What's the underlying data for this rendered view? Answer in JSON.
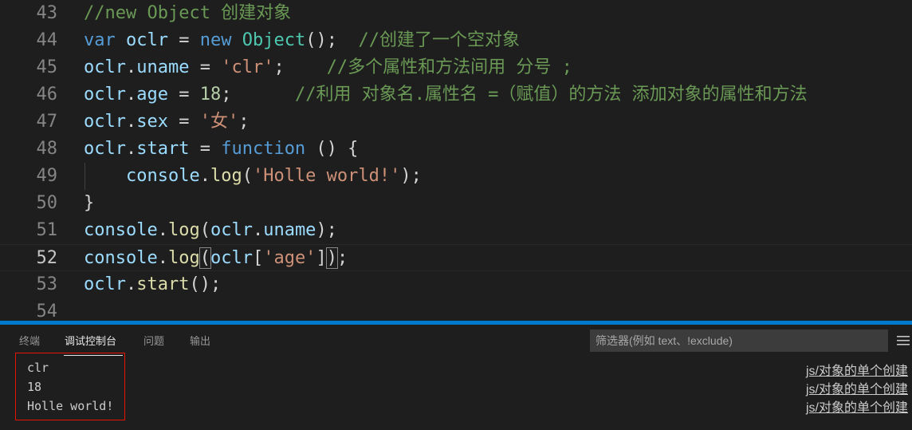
{
  "editor": {
    "lines": [
      {
        "num": "43",
        "tokens": [
          {
            "t": "//new Object 创建对象",
            "c": "cm"
          }
        ]
      },
      {
        "num": "44",
        "tokens": [
          {
            "t": "var",
            "c": "kw"
          },
          {
            "t": " ",
            "c": "pu"
          },
          {
            "t": "oclr",
            "c": "va"
          },
          {
            "t": " = ",
            "c": "pu"
          },
          {
            "t": "new",
            "c": "kw"
          },
          {
            "t": " ",
            "c": "pu"
          },
          {
            "t": "Object",
            "c": "ty"
          },
          {
            "t": "();  ",
            "c": "pu"
          },
          {
            "t": "//创建了一个空对象",
            "c": "cm"
          }
        ]
      },
      {
        "num": "45",
        "tokens": [
          {
            "t": "oclr",
            "c": "va"
          },
          {
            "t": ".",
            "c": "pu"
          },
          {
            "t": "uname",
            "c": "va"
          },
          {
            "t": " = ",
            "c": "pu"
          },
          {
            "t": "'clr'",
            "c": "st"
          },
          {
            "t": ";    ",
            "c": "pu"
          },
          {
            "t": "//多个属性和方法间用 分号 ;",
            "c": "cm"
          }
        ]
      },
      {
        "num": "46",
        "tokens": [
          {
            "t": "oclr",
            "c": "va"
          },
          {
            "t": ".",
            "c": "pu"
          },
          {
            "t": "age",
            "c": "va"
          },
          {
            "t": " = ",
            "c": "pu"
          },
          {
            "t": "18",
            "c": "nu"
          },
          {
            "t": ";      ",
            "c": "pu"
          },
          {
            "t": "//利用 对象名.属性名 =（赋值）的方法 添加对象的属性和方法",
            "c": "cm"
          }
        ]
      },
      {
        "num": "47",
        "tokens": [
          {
            "t": "oclr",
            "c": "va"
          },
          {
            "t": ".",
            "c": "pu"
          },
          {
            "t": "sex",
            "c": "va"
          },
          {
            "t": " = ",
            "c": "pu"
          },
          {
            "t": "'女'",
            "c": "st"
          },
          {
            "t": ";",
            "c": "pu"
          }
        ]
      },
      {
        "num": "48",
        "tokens": [
          {
            "t": "oclr",
            "c": "va"
          },
          {
            "t": ".",
            "c": "pu"
          },
          {
            "t": "start",
            "c": "va"
          },
          {
            "t": " = ",
            "c": "pu"
          },
          {
            "t": "function",
            "c": "kw"
          },
          {
            "t": " () {",
            "c": "pu"
          }
        ]
      },
      {
        "num": "49",
        "tokens": [
          {
            "t": "    ",
            "c": "pu"
          },
          {
            "t": "console",
            "c": "va"
          },
          {
            "t": ".",
            "c": "pu"
          },
          {
            "t": "log",
            "c": "fn"
          },
          {
            "t": "(",
            "c": "pu"
          },
          {
            "t": "'Holle world!'",
            "c": "st"
          },
          {
            "t": ");",
            "c": "pu"
          }
        ]
      },
      {
        "num": "50",
        "tokens": [
          {
            "t": "}",
            "c": "pu"
          }
        ]
      },
      {
        "num": "51",
        "tokens": [
          {
            "t": "console",
            "c": "va"
          },
          {
            "t": ".",
            "c": "pu"
          },
          {
            "t": "log",
            "c": "fn"
          },
          {
            "t": "(",
            "c": "pu"
          },
          {
            "t": "oclr",
            "c": "va"
          },
          {
            "t": ".",
            "c": "pu"
          },
          {
            "t": "uname",
            "c": "va"
          },
          {
            "t": ");",
            "c": "pu"
          }
        ]
      },
      {
        "num": "52",
        "current": true,
        "tokens": [
          {
            "t": "console",
            "c": "va"
          },
          {
            "t": ".",
            "c": "pu"
          },
          {
            "t": "log",
            "c": "fn"
          },
          {
            "t": "(",
            "c": "pu bm"
          },
          {
            "t": "oclr",
            "c": "va"
          },
          {
            "t": "[",
            "c": "pu"
          },
          {
            "t": "'age'",
            "c": "st"
          },
          {
            "t": "]",
            "c": "pu"
          },
          {
            "t": ")",
            "c": "pu bm"
          },
          {
            "t": ";",
            "c": "pu"
          }
        ]
      },
      {
        "num": "53",
        "tokens": [
          {
            "t": "oclr",
            "c": "va"
          },
          {
            "t": ".",
            "c": "pu"
          },
          {
            "t": "start",
            "c": "fn"
          },
          {
            "t": "();",
            "c": "pu"
          }
        ]
      },
      {
        "num": "54",
        "tokens": []
      }
    ]
  },
  "panel": {
    "tabs": {
      "terminal": "终端",
      "debug_console": "调试控制台",
      "problems": "问题",
      "output": "输出"
    },
    "filter_placeholder": "筛选器(例如 text、!exclude)",
    "console_lines": [
      {
        "text": "clr",
        "source": "js/对象的单个创建"
      },
      {
        "text": "18",
        "source": "js/对象的单个创建"
      },
      {
        "text": "Holle world!",
        "source": "js/对象的单个创建"
      }
    ]
  }
}
